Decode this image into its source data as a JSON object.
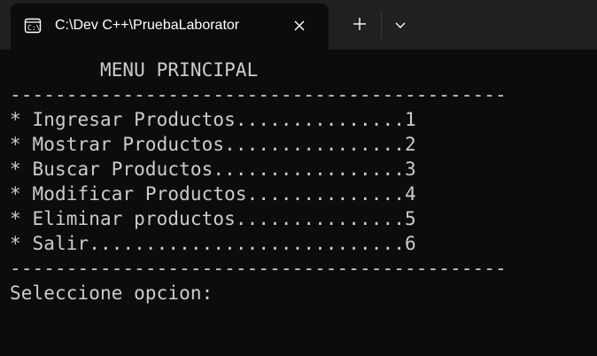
{
  "window": {
    "tab_title": "C:\\Dev C++\\PruebaLaborator",
    "tab_icon": "terminal-icon",
    "close_icon": "close-icon",
    "new_tab_icon": "plus-icon",
    "dropdown_icon": "chevron-down-icon"
  },
  "terminal": {
    "lines": [
      "        MENU PRINCIPAL",
      "--------------------------------------------",
      "* Ingresar Productos...............1",
      "* Mostrar Productos................2",
      "* Buscar Productos.................3",
      "* Modificar Productos..............4",
      "* Eliminar productos...............5",
      "* Salir............................6",
      "--------------------------------------------",
      "Seleccione opcion:"
    ]
  },
  "colors": {
    "terminal_bg": "#0c0c0c",
    "titlebar_bg": "#202020",
    "terminal_text": "#cccccc",
    "tab_text": "#ffffff"
  }
}
